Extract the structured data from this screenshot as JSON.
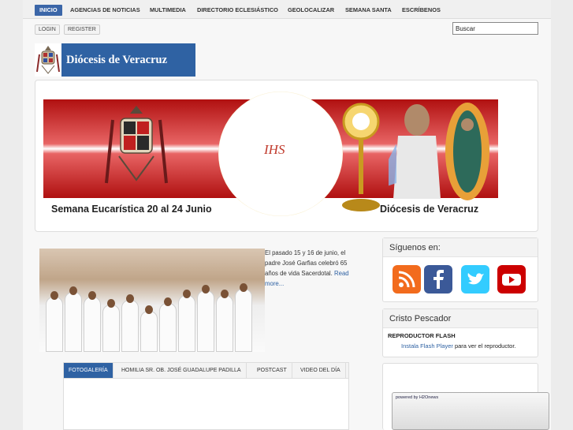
{
  "nav": {
    "items": [
      {
        "label": "INICIO",
        "active": true
      },
      {
        "label": "AGENCIAS DE NOTICIAS"
      },
      {
        "label": "MULTIMEDIA"
      },
      {
        "label": "DIRECTORIO ECLESIÁSTICO"
      },
      {
        "label": "GEOLOCALIZAR"
      },
      {
        "label": "SEMANA SANTA"
      },
      {
        "label": "ESCRÍBENOS"
      }
    ]
  },
  "account": {
    "login_label": "LOGIN",
    "register_label": "REGISTER"
  },
  "search": {
    "value": "Buscar"
  },
  "logo": {
    "title": "Diócesis de Veracruz"
  },
  "banner": {
    "medal_text": "IHS",
    "caption_left": "Semana Eucarística 20 al 24 Junio",
    "caption_right": "Diócesis de Veracruz"
  },
  "story": {
    "text": "El pasado 15 y 16 de junio, el padre José Garfias celebró 65 años de vida Sacerdotal.",
    "read_more": "Read more..."
  },
  "tabs": [
    {
      "label": "FOTOGALERÍA",
      "active": true
    },
    {
      "label": "HOMILIA SR. OB. JOSÉ GUADALUPE PADILLA"
    },
    {
      "label": "POSTCAST"
    },
    {
      "label": "VIDEO DEL DÍA"
    }
  ],
  "sidebar": {
    "follow_title": "Síguenos en:",
    "social": [
      {
        "icon": "rss-icon",
        "color": "#f26b1d"
      },
      {
        "icon": "facebook-icon",
        "color": "#3b5998"
      },
      {
        "icon": "twitter-icon",
        "color": "#33ccff"
      },
      {
        "icon": "youtube-icon",
        "color": "#cc0000"
      }
    ],
    "pescador_title": "Cristo Pescador",
    "flash_heading": "REPRODUCTOR FLASH",
    "flash_link": "Instala Flash Player",
    "flash_suffix": " para ver el reproductor.",
    "h2o_label": "powered by H2Onews"
  }
}
